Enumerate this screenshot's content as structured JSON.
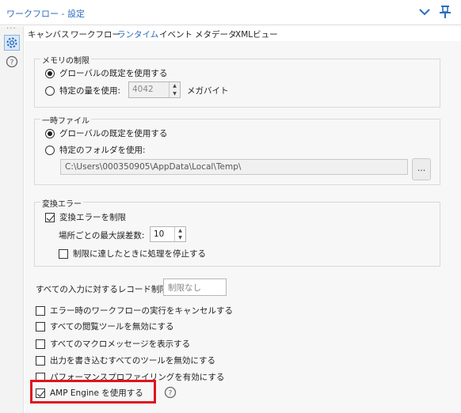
{
  "window": {
    "title": "ワークフロー - 設定"
  },
  "tabs": [
    "キャンバス",
    "ワークフロー",
    "ランタイム",
    "イベント",
    "メタデータ",
    "XMLビュー"
  ],
  "memory": {
    "legend": "メモリの制限",
    "global_default": "グローバルの既定を使用する",
    "specific": "特定の量を使用:",
    "specific_value": "4042",
    "unit": "メガバイト"
  },
  "tempfile": {
    "legend": "一時ファイル",
    "global_default": "グローバルの既定を使用する",
    "specific_folder": "特定のフォルダを使用:",
    "path": "C:\\Users\\000350905\\AppData\\Local\\Temp\\",
    "browse_label": "..."
  },
  "conversion": {
    "legend": "変換エラー",
    "limit_label": "変換エラーを制限",
    "max_per_location_label": "場所ごとの最大誤差数:",
    "max_per_location_value": "10",
    "stop_label": "制限に達したときに処理を停止する"
  },
  "record_limit": {
    "label": "すべての入力に対するレコード制限:",
    "placeholder": "制限なし"
  },
  "options": [
    {
      "label": "エラー時のワークフローの実行をキャンセルする",
      "checked": false
    },
    {
      "label": "すべての閲覧ツールを無効にする",
      "checked": false
    },
    {
      "label": "すべてのマクロメッセージを表示する",
      "checked": false
    },
    {
      "label": "出力を書き込むすべてのツールを無効にする",
      "checked": false
    },
    {
      "label": "パフォーマンスプロファイリングを有効にする",
      "checked": false
    },
    {
      "label": "AMP Engine を使用する",
      "checked": true
    }
  ],
  "colors": {
    "accent": "#2c6ebe",
    "highlight": "#e0141e"
  }
}
